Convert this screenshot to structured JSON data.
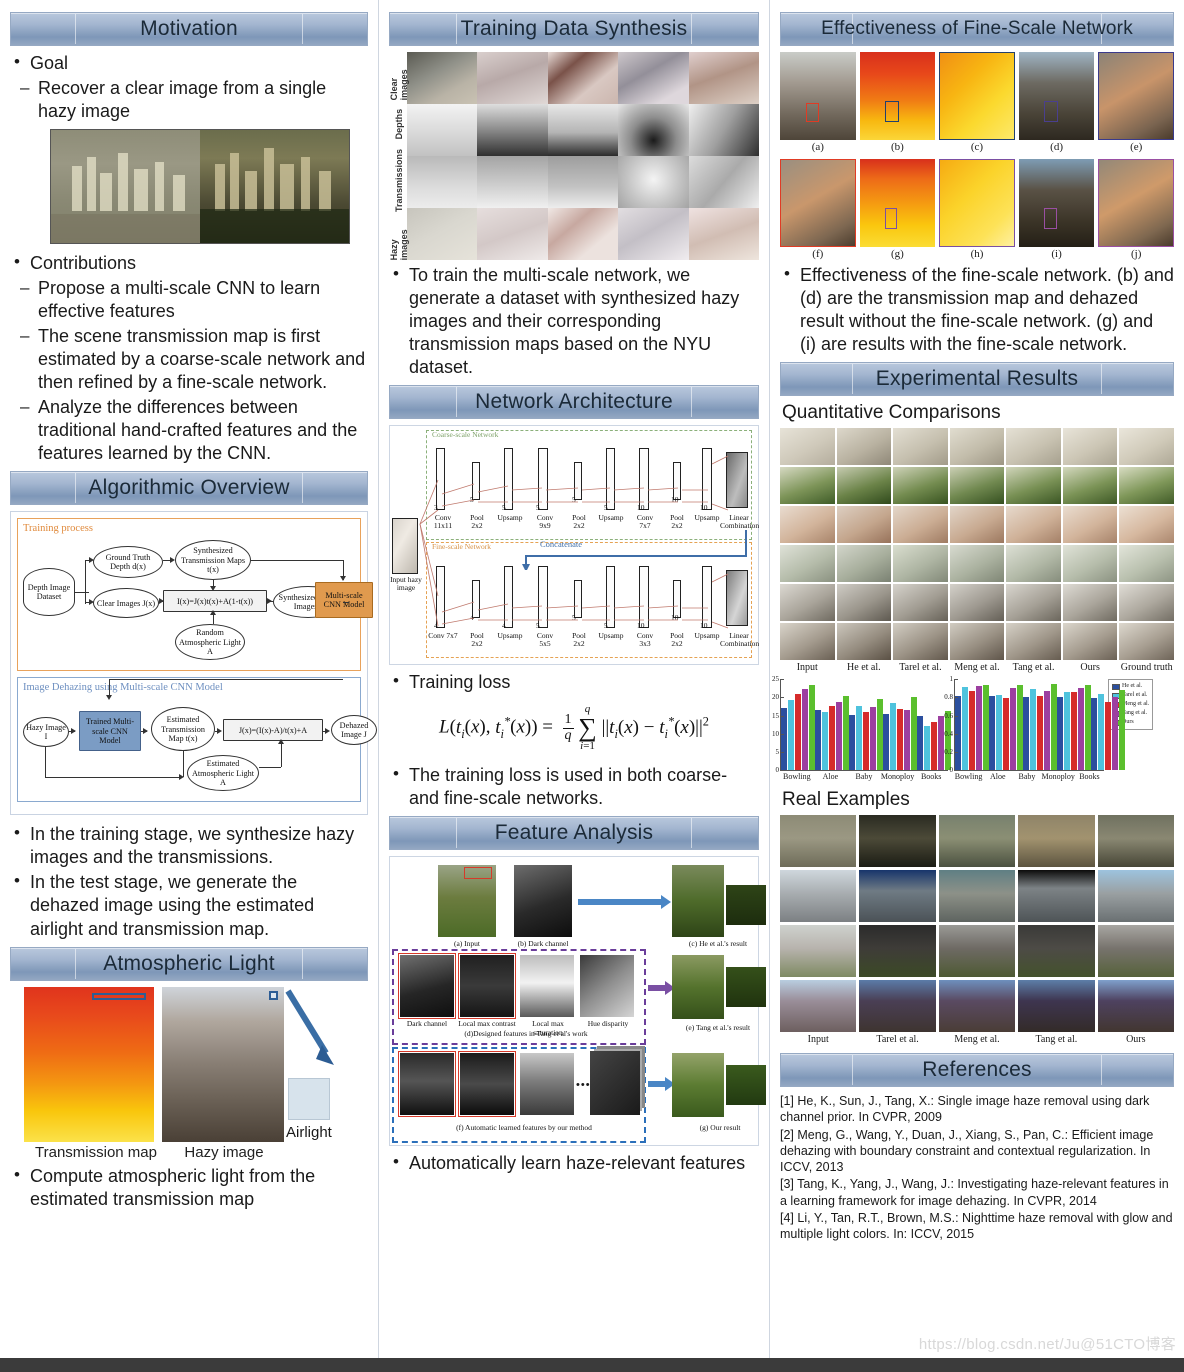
{
  "colors": {
    "banner_top": "#b9c8dd",
    "banner_bottom": "#93a7c2",
    "accent_orange": "#e09a4e",
    "accent_blue": "#7b9cc4",
    "series": [
      "#2b4f9e",
      "#4fc3dd",
      "#d62b2b",
      "#9c3fa0",
      "#5bbf2e"
    ]
  },
  "left_column": {
    "motivation": {
      "title": "Motivation",
      "goal_label": "Goal",
      "goal_text": "Recover a clear image from a single hazy image",
      "figure_name": "hazy-vs-clear-cityscape",
      "contributions_label": "Contributions",
      "contributions": [
        "Propose a multi-scale CNN to learn effective features",
        "The scene transmission map is first estimated by a coarse-scale network and then refined by a fine-scale network.",
        "Analyze the differences between traditional hand-crafted features and the features learned by the CNN."
      ]
    },
    "algorithmic_overview": {
      "title": "Algorithmic Overview",
      "training_process_label": "Training process",
      "dehazing_label": "Image Dehazing using Multi-scale CNN Model",
      "nodes_training": [
        "Depth Image Dataset",
        "Ground Truth Depth d(x)",
        "Clear Images J(x)",
        "Synthesized Transmission Maps t(x)",
        "I(x)=J(x)t(x)+A(1-t(x))",
        "Random Atmospheric Light A",
        "Synthesized Hazy Images I",
        "Multi-scale CNN Model"
      ],
      "nodes_dehazing": [
        "Hazy Image I",
        "Trained Multi-scale CNN Model",
        "Estimated Transmission Map t(x)",
        "J(x)=(I(x)-A)/t(x)+A",
        "Dehazed Image J",
        "Estimated Atmospheric Light A"
      ],
      "bullets": [
        "In the training stage, we synthesize hazy images and the transmissions.",
        "In the test stage, we generate the dehazed image using the estimated airlight and transmission map."
      ]
    },
    "atmospheric_light": {
      "title": "Atmospheric Light",
      "caption_transmission": "Transmission map",
      "caption_hazy": "Hazy image",
      "caption_airlight": "Airlight",
      "bullet": "Compute atmospheric light from the estimated transmission map"
    }
  },
  "middle_column": {
    "training_data_synthesis": {
      "title": "Training Data Synthesis",
      "row_labels": [
        "Clear images",
        "Depths",
        "Transmissions",
        "Hazy images"
      ],
      "bullet": "To train the multi-scale network, we generate a dataset with synthesized hazy images and their corresponding transmission maps based on the NYU dataset."
    },
    "network_architecture": {
      "title": "Network Architecture",
      "input_label": "Input hazy image",
      "coarse_label": "Coarse-scale Network",
      "fine_label": "Fine-scale Network",
      "concatenate_label": "Concatenate",
      "coarse_layers": [
        {
          "name": "Conv 11x11",
          "ch": "3"
        },
        {
          "name": "Pool 2x2",
          "ch": "5"
        },
        {
          "name": "Upsamp",
          "ch": "5"
        },
        {
          "name": "Conv 9x9",
          "ch": "5"
        },
        {
          "name": "Pool 2x2",
          "ch": "5"
        },
        {
          "name": "Upsamp",
          "ch": "5"
        },
        {
          "name": "Conv 7x7",
          "ch": "10"
        },
        {
          "name": "Pool 2x2",
          "ch": "10"
        },
        {
          "name": "Upsamp",
          "ch": "10"
        },
        {
          "name": "Linear Combination",
          "ch": ""
        }
      ],
      "fine_layers": [
        {
          "name": "Conv 7x7",
          "ch": "4"
        },
        {
          "name": "Pool 2x2",
          "ch": "4"
        },
        {
          "name": "Upsamp",
          "ch": "4"
        },
        {
          "name": "Conv 5x5",
          "ch": "5"
        },
        {
          "name": "Pool 2x2",
          "ch": "5"
        },
        {
          "name": "Upsamp",
          "ch": "5"
        },
        {
          "name": "Conv 3x3",
          "ch": "10"
        },
        {
          "name": "Pool 2x2",
          "ch": "10"
        },
        {
          "name": "Upsamp",
          "ch": "10"
        },
        {
          "name": "Linear Combination",
          "ch": ""
        }
      ],
      "training_loss_label": "Training loss",
      "formula_plain": "L(t_i(x), t_i*(x)) = (1/q) SUM_{i=1}^{q} ||t_i(x) - t_i*(x)||^2",
      "loss_bullet": "The training loss is used in both coarse- and fine-scale networks."
    },
    "feature_analysis": {
      "title": "Feature Analysis",
      "captions": [
        "(a) Input",
        "(b) Dark channel",
        "(c) He et al.'s result",
        "Dark channel",
        "Local max contrast",
        "Local max saturation",
        "Hue disparity",
        "(d)Designed features in Tang et al's work",
        "(e) Tang et al.'s result",
        "(f) Automatic learned features by our method",
        "(g) Our result"
      ],
      "bullet": "Automatically learn haze-relevant features"
    }
  },
  "right_column": {
    "fine_scale": {
      "title": "Effectiveness of Fine-Scale Network",
      "labels_row1": [
        "(a)",
        "(b)",
        "(c)",
        "(d)",
        "(e)"
      ],
      "labels_row2": [
        "(f)",
        "(g)",
        "(h)",
        "(i)",
        "(j)"
      ],
      "bullet": "Effectiveness of the fine-scale network. (b) and (d) are the transmission map and dehazed result without the fine-scale network. (g) and (i) are results with the fine-scale network."
    },
    "experimental_results": {
      "title": "Experimental Results",
      "quantitative_label": "Quantitative Comparisons",
      "columns": [
        "Input",
        "He et al.",
        "Tarel et al.",
        "Meng et al.",
        "Tang et al.",
        "Ours",
        "Ground truth"
      ],
      "real_examples_label": "Real Examples",
      "real_columns": [
        "Input",
        "Tarel et al.",
        "Meng et al.",
        "Tang et al.",
        "Ours"
      ]
    },
    "references": {
      "title": "References",
      "items": [
        "[1] He, K., Sun, J., Tang, X.: Single image haze removal using dark channel prior. In CVPR, 2009",
        "[2] Meng, G., Wang, Y., Duan, J., Xiang, S., Pan, C.: Efficient image dehazing with boundary constraint and contextual regularization. In ICCV, 2013",
        "[3] Tang, K., Yang, J., Wang, J.: Investigating haze-relevant features in a learning framework for image dehazing. In CVPR, 2014",
        "[4] Li, Y., Tan, R.T., Brown, M.S.: Nighttime haze removal with glow and multiple light colors. In: ICCV, 2015"
      ]
    }
  },
  "watermark": "https://blog.csdn.net/Ju@51CTO博客",
  "chart_data": [
    {
      "type": "bar",
      "title": "",
      "categories": [
        "Bowling",
        "Aloe",
        "Baby",
        "Monoploy",
        "Books"
      ],
      "series": [
        {
          "name": "He et al.",
          "values": [
            17.1,
            16.5,
            15.2,
            15.5,
            14.8
          ]
        },
        {
          "name": "Tarel et al.",
          "values": [
            19.3,
            16.1,
            17.5,
            18.5,
            12.1
          ]
        },
        {
          "name": "Meng et al.",
          "values": [
            20.9,
            17.7,
            16.1,
            16.8,
            13.1
          ]
        },
        {
          "name": "Tang et al.",
          "values": [
            22.3,
            18.7,
            17.3,
            16.6,
            14.8
          ]
        },
        {
          "name": "Ours",
          "values": [
            23.3,
            20.5,
            19.5,
            20.2,
            16.2
          ]
        }
      ],
      "ylim": [
        0,
        25
      ],
      "yticks": [
        0,
        5,
        10,
        15,
        20,
        25
      ],
      "xlabel": "",
      "ylabel": "",
      "legend": false,
      "grid": false
    },
    {
      "type": "bar",
      "title": "",
      "categories": [
        "Bowling",
        "Aloe",
        "Baby",
        "Monoploy",
        "Books"
      ],
      "series": [
        {
          "name": "He et al.",
          "values": [
            0.82,
            0.82,
            0.8,
            0.8,
            0.79
          ]
        },
        {
          "name": "Tarel et al.",
          "values": [
            0.91,
            0.83,
            0.89,
            0.86,
            0.84
          ]
        },
        {
          "name": "Meng et al.",
          "values": [
            0.87,
            0.79,
            0.81,
            0.86,
            0.75
          ]
        },
        {
          "name": "Tang et al.",
          "values": [
            0.93,
            0.9,
            0.87,
            0.9,
            0.8
          ]
        },
        {
          "name": "Ours",
          "values": [
            0.94,
            0.94,
            0.95,
            0.94,
            0.88
          ]
        }
      ],
      "ylim": [
        0,
        1
      ],
      "yticks": [
        0,
        0.2,
        0.4,
        0.6,
        0.8,
        1
      ],
      "xlabel": "",
      "ylabel": "",
      "legend": true,
      "legend_position": "right",
      "grid": false
    }
  ]
}
